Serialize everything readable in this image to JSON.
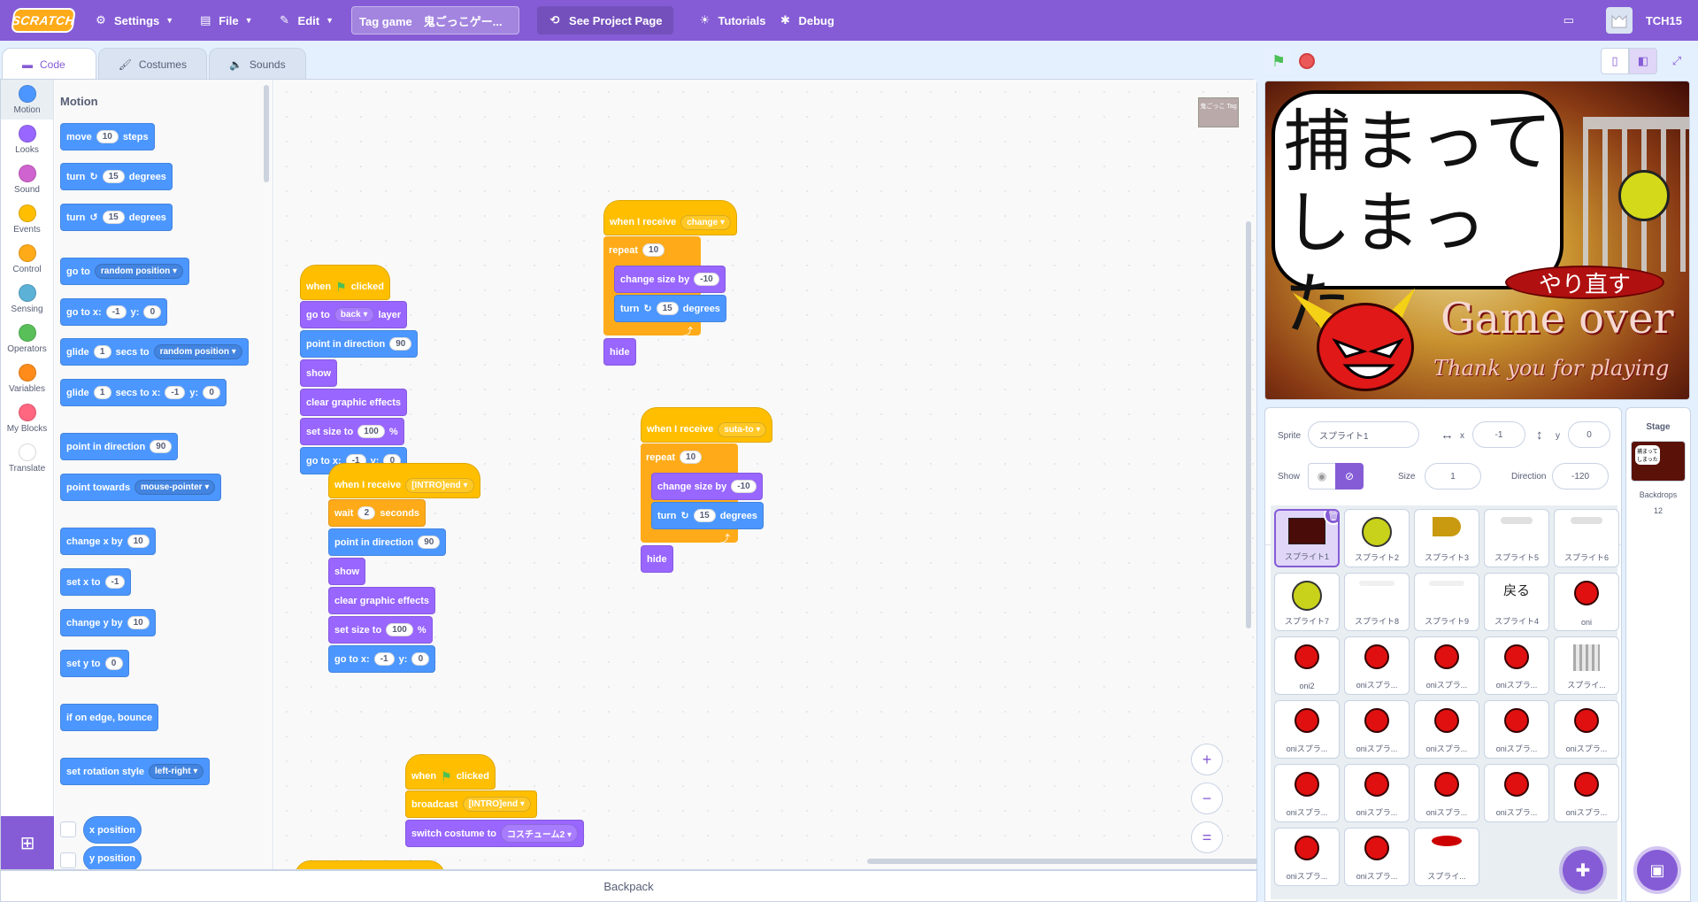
{
  "menubar": {
    "logo": "SCRATCH",
    "settings": "Settings",
    "file": "File",
    "edit": "Edit",
    "project_title": "Tag game　鬼ごっこゲー...",
    "see_project": "See Project Page",
    "tutorials": "Tutorials",
    "debug": "Debug",
    "username": "TCH15"
  },
  "tabs": {
    "code": "Code",
    "costumes": "Costumes",
    "sounds": "Sounds"
  },
  "categories": [
    {
      "label": "Motion",
      "color": "#4c97ff"
    },
    {
      "label": "Looks",
      "color": "#9966ff"
    },
    {
      "label": "Sound",
      "color": "#cf63cf"
    },
    {
      "label": "Events",
      "color": "#ffbf00"
    },
    {
      "label": "Control",
      "color": "#ffab19"
    },
    {
      "label": "Sensing",
      "color": "#5cb1d6"
    },
    {
      "label": "Operators",
      "color": "#59c059"
    },
    {
      "label": "Variables",
      "color": "#ff8c1a"
    },
    {
      "label": "My Blocks",
      "color": "#ff6680"
    },
    {
      "label": "Translate",
      "color": "#ffffff"
    }
  ],
  "palette": {
    "heading": "Motion",
    "move": {
      "a": "move",
      "n": "10",
      "b": "steps"
    },
    "turn_right": {
      "a": "turn",
      "n": "15",
      "b": "degrees"
    },
    "turn_left": {
      "a": "turn",
      "n": "15",
      "b": "degrees"
    },
    "goto": {
      "a": "go to",
      "dd": "random position"
    },
    "goto_xy": {
      "a": "go to x:",
      "x": "-1",
      "b": "y:",
      "y": "0"
    },
    "glide_to": {
      "a": "glide",
      "n": "1",
      "b": "secs to",
      "dd": "random position"
    },
    "glide_xy": {
      "a": "glide",
      "n": "1",
      "b": "secs to x:",
      "x": "-1",
      "c": "y:",
      "y": "0"
    },
    "point_dir": {
      "a": "point in direction",
      "n": "90"
    },
    "point_towards": {
      "a": "point towards",
      "dd": "mouse-pointer"
    },
    "change_x": {
      "a": "change x by",
      "n": "10"
    },
    "set_x": {
      "a": "set x to",
      "n": "-1"
    },
    "change_y": {
      "a": "change y by",
      "n": "10"
    },
    "set_y": {
      "a": "set y to",
      "n": "0"
    },
    "bounce": "if on edge, bounce",
    "rotation": {
      "a": "set rotation style",
      "dd": "left-right"
    },
    "xpos": "x position",
    "ypos": "y position"
  },
  "scripts": {
    "s1": {
      "hat_a": "when",
      "hat_b": "clicked",
      "goto_a": "go to",
      "goto_dd": "back",
      "goto_b": "layer",
      "point_a": "point in direction",
      "point_n": "90",
      "show": "show",
      "clear": "clear graphic effects",
      "size_a": "set size to",
      "size_n": "100",
      "size_b": "%",
      "gxy_a": "go to x:",
      "gxy_x": "-1",
      "gxy_b": "y:",
      "gxy_y": "0"
    },
    "s2": {
      "hat_a": "when I receive",
      "hat_dd": "[INTRO]end",
      "wait_a": "wait",
      "wait_n": "2",
      "wait_b": "seconds",
      "point_a": "point in direction",
      "point_n": "90",
      "show": "show",
      "clear": "clear graphic effects",
      "size_a": "set size to",
      "size_n": "100",
      "size_b": "%",
      "gxy_a": "go to x:",
      "gxy_x": "-1",
      "gxy_b": "y:",
      "gxy_y": "0"
    },
    "s3": {
      "hat_a": "when I receive",
      "hat_dd": "change",
      "repeat_a": "repeat",
      "repeat_n": "10",
      "csize_a": "change size by",
      "csize_n": "-10",
      "turn_a": "turn",
      "turn_n": "15",
      "turn_b": "degrees",
      "hide": "hide"
    },
    "s4": {
      "hat_a": "when I receive",
      "hat_dd": "suta-to",
      "repeat_a": "repeat",
      "repeat_n": "10",
      "csize_a": "change size by",
      "csize_n": "-10",
      "turn_a": "turn",
      "turn_n": "15",
      "turn_b": "degrees",
      "hide": "hide"
    },
    "s5": {
      "hat_a": "when",
      "hat_b": "clicked",
      "bc_a": "broadcast",
      "bc_dd": "[INTRO]end",
      "sw_a": "switch costume to",
      "sw_dd": "コスチューム2"
    },
    "corner_thumb": "鬼ごっこ Tag"
  },
  "zoom": {
    "in": "+",
    "out": "−",
    "reset": "="
  },
  "backpack": "Backpack",
  "stage": {
    "speech_line1": "捕まって",
    "speech_line2": "しまった。",
    "redo": "やり直す",
    "gameover": "Game over",
    "thanks": "Thank you for playing"
  },
  "sprite_info": {
    "sprite_label": "Sprite",
    "sprite_name": "スプライト1",
    "x_label": "x",
    "x": "-1",
    "y_label": "y",
    "y": "0",
    "show_label": "Show",
    "size_label": "Size",
    "size": "1",
    "direction_label": "Direction",
    "direction": "-120"
  },
  "sprites": [
    {
      "name": "スプライト1",
      "thumb": "scene",
      "selected": true
    },
    {
      "name": "スプライト2",
      "thumb": "yellow"
    },
    {
      "name": "スプライト3",
      "thumb": "cone"
    },
    {
      "name": "スプライト5",
      "thumb": "faint"
    },
    {
      "name": "スプライト6",
      "thumb": "faint"
    },
    {
      "name": "スプライト7",
      "thumb": "yellow"
    },
    {
      "name": "スプライト8",
      "thumb": "faint2"
    },
    {
      "name": "スプライト9",
      "thumb": "faint2"
    },
    {
      "name": "スプライト4",
      "thumb": "text",
      "text": "戻る"
    },
    {
      "name": "oni",
      "thumb": "red"
    },
    {
      "name": "oni2",
      "thumb": "red"
    },
    {
      "name": "oniスプラ...",
      "thumb": "red"
    },
    {
      "name": "oniスプラ...",
      "thumb": "red"
    },
    {
      "name": "oniスプラ...",
      "thumb": "red"
    },
    {
      "name": "スプライ...",
      "thumb": "cage"
    },
    {
      "name": "oniスプラ...",
      "thumb": "red"
    },
    {
      "name": "oniスプラ...",
      "thumb": "red"
    },
    {
      "name": "oniスプラ...",
      "thumb": "red"
    },
    {
      "name": "oniスプラ...",
      "thumb": "red"
    },
    {
      "name": "oniスプラ...",
      "thumb": "red"
    },
    {
      "name": "oniスプラ...",
      "thumb": "red"
    },
    {
      "name": "oniスプラ...",
      "thumb": "red"
    },
    {
      "name": "oniスプラ...",
      "thumb": "red"
    },
    {
      "name": "oniスプラ...",
      "thumb": "red"
    },
    {
      "name": "oniスプラ...",
      "thumb": "red"
    },
    {
      "name": "oniスプラ...",
      "thumb": "red"
    },
    {
      "name": "oniスプラ...",
      "thumb": "red"
    },
    {
      "name": "スプライ...",
      "thumb": "pill"
    }
  ],
  "stage_pane": {
    "title": "Stage",
    "backdrops_label": "Backdrops",
    "backdrops_count": "12",
    "thumb_text": "捕まって しまった"
  }
}
